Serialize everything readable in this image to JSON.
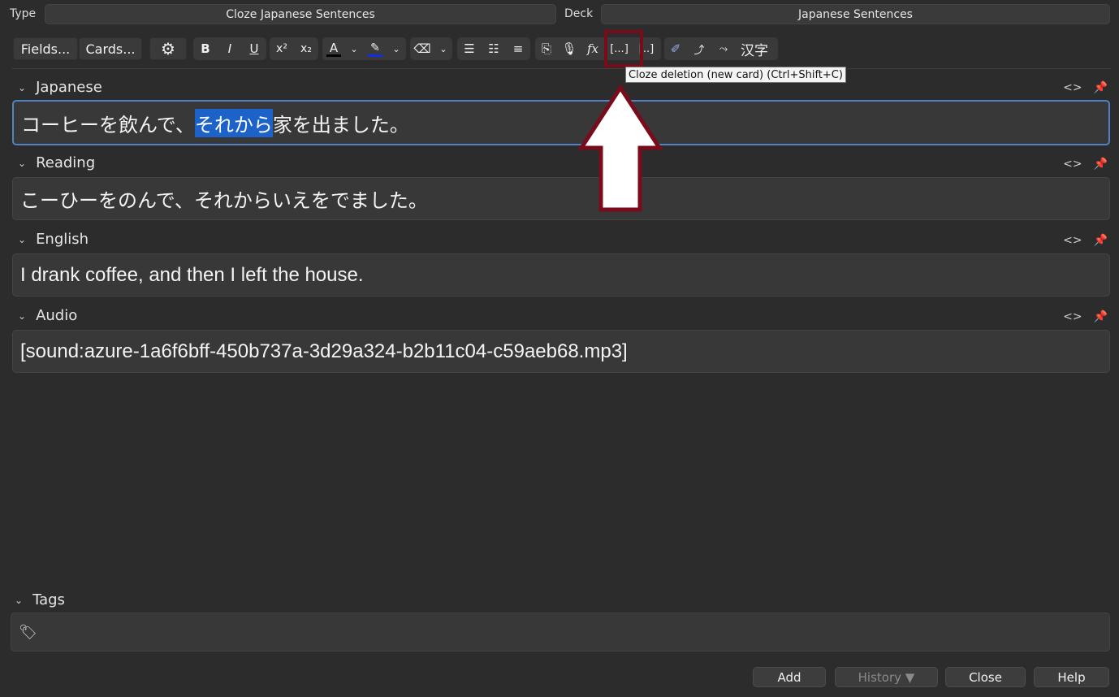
{
  "header": {
    "type_label": "Type",
    "type_value": "Cloze Japanese Sentences",
    "deck_label": "Deck",
    "deck_value": "Japanese Sentences"
  },
  "toolbar": {
    "fields_label": "Fields...",
    "cards_label": "Cards...",
    "bold": "B",
    "italic": "I",
    "underline": "U",
    "superscript": "x²",
    "subscript": "x₂",
    "font_color": "A",
    "cloze_new": "[...]",
    "cloze_same": "[..]",
    "kanji": "汉字",
    "accent_color": "#7a0b1b"
  },
  "tooltip": "Cloze deletion (new card) (Ctrl+Shift+C)",
  "fields": [
    {
      "label": "Japanese",
      "value_before": "コーヒーを飲んで、",
      "value_selected": "それから",
      "value_after": "家を出ました。"
    },
    {
      "label": "Reading",
      "value": "こーひーをのんで、それからいえをでました。"
    },
    {
      "label": "English",
      "value": "I drank coffee, and then I left the house."
    },
    {
      "label": "Audio",
      "value": "[sound:azure-1a6f6bff-450b737a-3d29a324-b2b11c04-c59aeb68.mp3]"
    }
  ],
  "tags": {
    "label": "Tags"
  },
  "buttons": {
    "add": "Add",
    "history": "History ▼",
    "close": "Close",
    "help": "Help"
  }
}
